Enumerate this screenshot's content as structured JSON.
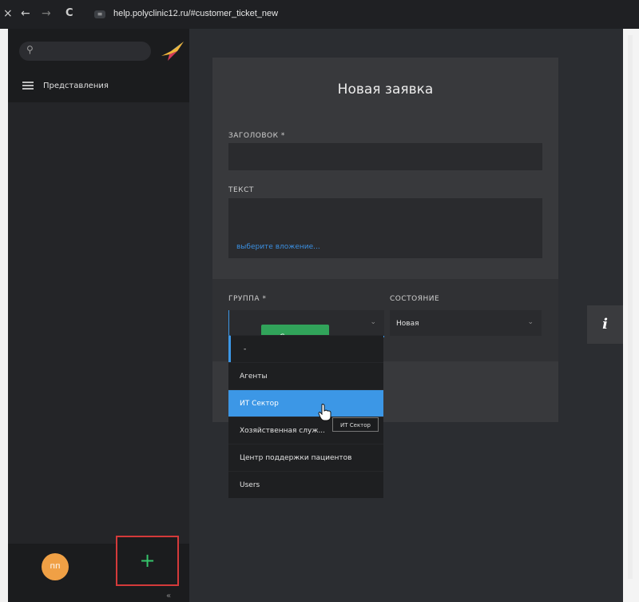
{
  "browser": {
    "url": "help.polyclinic12.ru/#customer_ticket_new",
    "back": "←",
    "forward": "→",
    "reload": "C"
  },
  "sidebar": {
    "search_icon": "search-icon",
    "views_label": "Представления",
    "avatar_initials": "пп",
    "add_label": "+",
    "collapse_label": "«"
  },
  "modal": {
    "title": "Новая заявка",
    "title_field_label": "ЗАГОЛОВОК *",
    "title_value": "",
    "text_field_label": "ТЕКСТ",
    "text_value": "",
    "attach_label": "выберите вложение...",
    "group_label": "ГРУППА *",
    "group_value": "",
    "state_label": "СОСТОЯНИЕ",
    "state_value": "Новая",
    "create_label": "Создать"
  },
  "group_dropdown": {
    "options": [
      "-",
      "Агенты",
      "ИТ Сектор",
      "Хозяйственная служ...",
      "Центр поддержки пациентов",
      "Users"
    ],
    "highlighted": "ИТ Сектор",
    "tooltip": "ИТ Сектор"
  },
  "info_button": "i",
  "colors": {
    "accent": "#3c97e6",
    "create": "#31a35a",
    "avatar": "#f0a045",
    "add": "#36c46b",
    "highlight_border": "#d43a3a"
  }
}
